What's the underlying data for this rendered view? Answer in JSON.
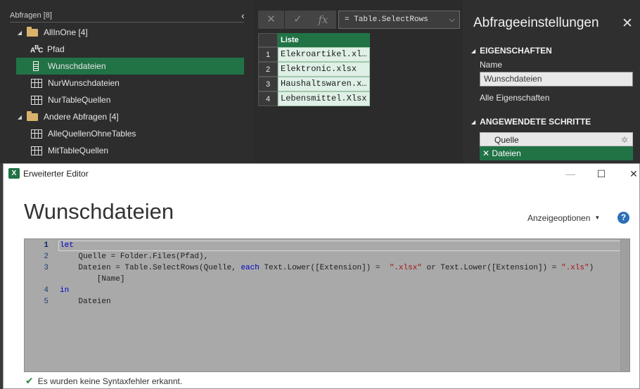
{
  "queries_pane": {
    "header": "Abfragen [8]",
    "items": [
      {
        "label": "AllInOne [4]",
        "kind": "folder",
        "depth": 0
      },
      {
        "label": "Pfad",
        "kind": "text",
        "depth": 1
      },
      {
        "label": "Wunschdateien",
        "kind": "list",
        "depth": 1,
        "selected": true
      },
      {
        "label": "NurWunschdateien",
        "kind": "table",
        "depth": 1
      },
      {
        "label": "NurTableQuellen",
        "kind": "table",
        "depth": 1
      },
      {
        "label": "Andere Abfragen [4]",
        "kind": "folder",
        "depth": 0
      },
      {
        "label": "AlleQuellenOhneTables",
        "kind": "table",
        "depth": 1
      },
      {
        "label": "MitTableQuellen",
        "kind": "table",
        "depth": 1
      }
    ]
  },
  "formula_bar": {
    "cancel_icon": "✕",
    "commit_icon": "✓",
    "fx_label": "fx",
    "formula": "= Table.SelectRows"
  },
  "preview": {
    "column_header": "Liste",
    "rows": [
      {
        "num": "1",
        "value": "Elekroartikel.xl…"
      },
      {
        "num": "2",
        "value": "Elektronic.xlsx"
      },
      {
        "num": "3",
        "value": "Haushaltswaren.x…"
      },
      {
        "num": "4",
        "value": "Lebensmittel.Xlsx"
      }
    ]
  },
  "settings": {
    "title": "Abfrageeinstellungen",
    "properties_heading": "EIGENSCHAFTEN",
    "name_label": "Name",
    "name_value": "Wunschdateien",
    "all_properties_link": "Alle Eigenschaften",
    "steps_heading": "ANGEWENDETE SCHRITTE",
    "steps": [
      {
        "label": "Quelle",
        "active": false
      },
      {
        "label": "Dateien",
        "active": true
      }
    ]
  },
  "editor": {
    "window_title": "Erweiterter Editor",
    "heading": "Wunschdateien",
    "view_options": "Anzeigeoptionen",
    "help": "?",
    "code_lines": [
      {
        "num": "1",
        "text": ""
      },
      {
        "num": "2",
        "text": "    Quelle = Folder.Files(Pfad),"
      },
      {
        "num": "3",
        "text": ""
      },
      {
        "num": "",
        "text": "        [Name]"
      },
      {
        "num": "4",
        "text": ""
      },
      {
        "num": "5",
        "text": "    Dateien"
      }
    ],
    "keywords": {
      "let": "let",
      "in": "in",
      "each": "each"
    },
    "line3": {
      "part1": "    Dateien = Table.SelectRows(Quelle, ",
      "part2": " Text.Lower([Extension]) =  ",
      "str1": "\".xlsx\"",
      "part3": " or Text.Lower([Extension]) = ",
      "str2": "\".xls\"",
      "part4": ")"
    },
    "status_message": "Es wurden keine Syntaxfehler erkannt."
  },
  "colors": {
    "excel_green": "#217346",
    "keyword_blue": "#0000c8",
    "string_red": "#a31515",
    "help_blue": "#2b6fb6"
  }
}
